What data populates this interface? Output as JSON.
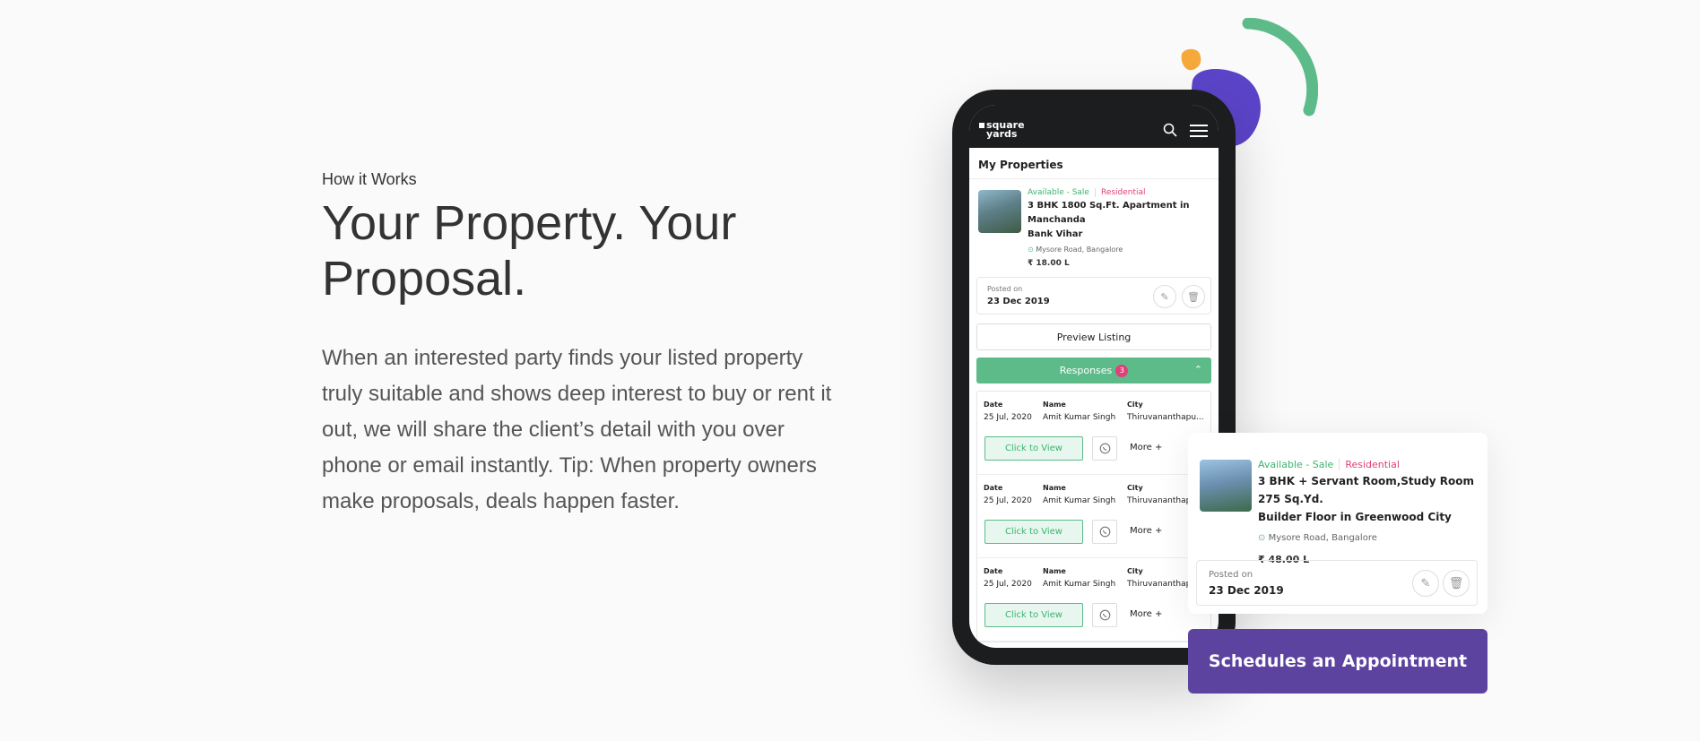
{
  "intro": {
    "eyebrow": "How it Works",
    "headline_line1": "Your Property. Your",
    "headline_line2": "Proposal.",
    "body": "When an interested party finds your listed property truly suitable and shows deep interest to buy or rent it out, we will share the client’s detail with you over phone or email instantly. Tip: When property owners make proposals, deals happen faster."
  },
  "phone": {
    "logo_line1": "square",
    "logo_line2": "yards",
    "section_title": "My Properties",
    "listing": {
      "tag_status": "Available - Sale",
      "tag_type": "Residential",
      "title_line1": "3 BHK 1800 Sq.Ft. Apartment in Manchanda",
      "title_line2": "Bank Vihar",
      "location": "Mysore Road, Bangalore",
      "price": "₹ 18.00 L",
      "posted_label": "Posted on",
      "posted_date": "23 Dec 2019"
    },
    "preview_button": "Preview Listing",
    "responses_label": "Responses",
    "responses_count": "3",
    "response_headers": {
      "date": "Date",
      "name": "Name",
      "city": "City"
    },
    "responses": [
      {
        "date": "25 Jul, 2020",
        "name": "Amit Kumar Singh",
        "city": "Thiruvananthapu...",
        "cta": "Click to View",
        "more": "More +"
      },
      {
        "date": "25 Jul, 2020",
        "name": "Amit Kumar Singh",
        "city": "Thiruvananthap",
        "cta": "Click to View",
        "more": "More +"
      },
      {
        "date": "25 Jul, 2020",
        "name": "Amit Kumar Singh",
        "city": "Thiruvananthap",
        "cta": "Click to View",
        "more": "More +"
      }
    ]
  },
  "float_card": {
    "tag_status": "Available - Sale",
    "tag_type": "Residential",
    "title_line1": "3 BHK + Servant Room,Study Room 275 Sq.Yd.",
    "title_line2": "Builder Floor in Greenwood City",
    "location": "Mysore Road, Bangalore",
    "price": "₹ 48.00 L",
    "posted_label": "Posted on",
    "posted_date": "23 Dec 2019"
  },
  "appointment_button": "Schedules an Appointment",
  "colors": {
    "green": "#5dbb8a",
    "purple": "#5c43a0",
    "pink": "#e0407b",
    "orange": "#f5a93a",
    "indigo": "#5b44c8"
  }
}
